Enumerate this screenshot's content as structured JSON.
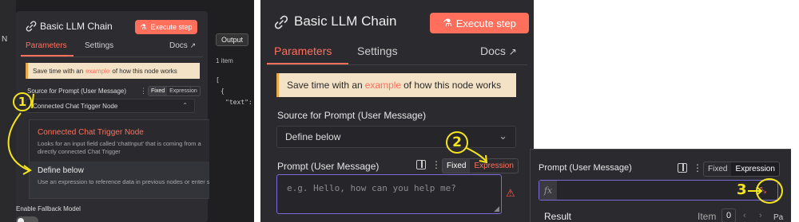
{
  "panel1": {
    "left_fragment": "N",
    "title": "Basic LLM Chain",
    "execute_label": "Execute step",
    "tabs": [
      "Parameters",
      "Settings"
    ],
    "docs_label": "Docs",
    "banner": {
      "before": "Save time with an",
      "link": "example",
      "after": "of how this node works"
    },
    "source_label": "Source for Prompt (User Message)",
    "toggle_fixed": "Fixed",
    "toggle_expression": "Expression",
    "source_value": "Connected Chat Trigger Node",
    "dropdown": [
      {
        "title": "Connected Chat Trigger Node",
        "desc": "Looks for an input field called 'chatInput' that is coming from a directly connected Chat Trigger"
      },
      {
        "title": "Define below",
        "desc": "Use an expression to reference data in previous nodes or enter static text"
      }
    ],
    "fallback_label": "Enable Fallback Model",
    "output_label": "Output",
    "output_count": "1 item",
    "json_lines": [
      "[",
      "{",
      "\"text\":"
    ],
    "annotation": "1"
  },
  "panel2": {
    "title": "Basic LLM Chain",
    "execute_label": "Execute step",
    "tabs": [
      "Parameters",
      "Settings"
    ],
    "docs_label": "Docs",
    "banner": {
      "before": "Save time with an",
      "link": "example",
      "after": "of how this node works"
    },
    "source_label": "Source for Prompt (User Message)",
    "source_value": "Define below",
    "prompt_label": "Prompt (User Message)",
    "toggle_fixed": "Fixed",
    "toggle_expression": "Expression",
    "prompt_placeholder": "e.g. Hello, how can you help me?",
    "annotation": "2"
  },
  "panel3": {
    "prompt_label": "Prompt (User Message)",
    "toggle_fixed": "Fixed",
    "toggle_expression": "Expression",
    "fx_label": "fx",
    "result_label": "Result",
    "item_label": "Item",
    "item_value": "0",
    "pagination_fragment": "Pa",
    "annotation": "3"
  },
  "colors": {
    "accent": "#ff6f5c",
    "annotation": "#f5e51c",
    "banner": "#f4e2c6",
    "panel": "#2b2b2f"
  }
}
